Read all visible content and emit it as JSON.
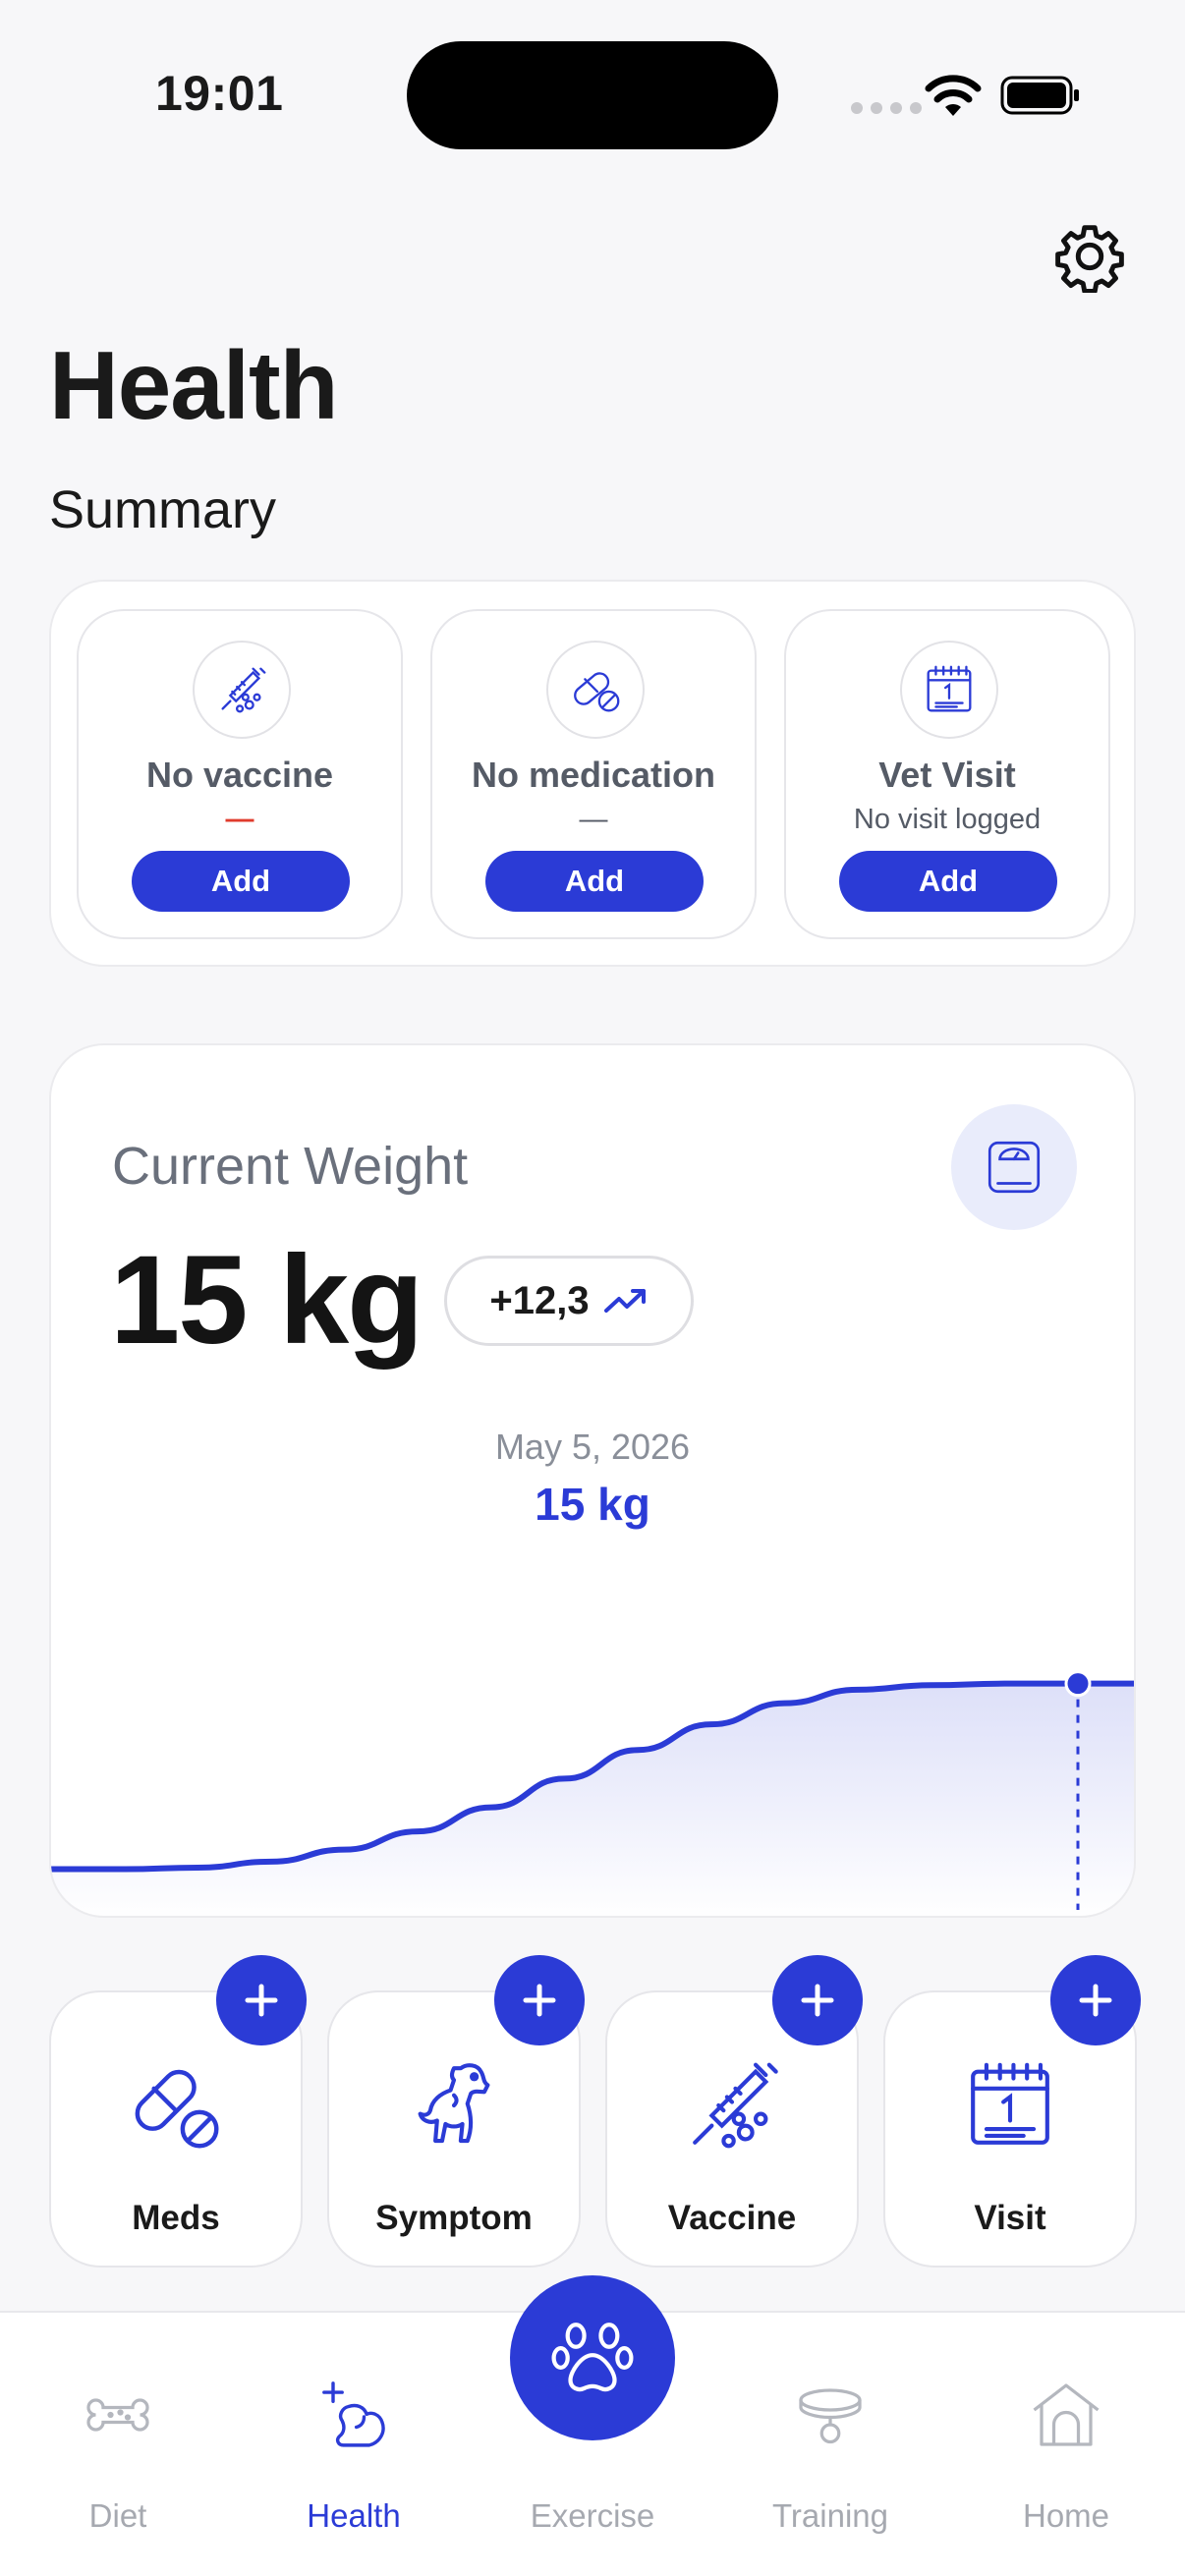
{
  "status_bar": {
    "time": "19:01"
  },
  "header": {
    "title": "Health",
    "summary_title": "Summary"
  },
  "summary": [
    {
      "title": "No vaccine",
      "subtitle": "—",
      "button": "Add",
      "icon": "vaccine-icon"
    },
    {
      "title": "No medication",
      "subtitle": "—",
      "button": "Add",
      "icon": "pill-icon"
    },
    {
      "title": "Vet Visit",
      "subtitle": "No visit logged",
      "button": "Add",
      "icon": "calendar-icon"
    }
  ],
  "weight": {
    "label": "Current Weight",
    "value": "15 kg",
    "change": "+12,3",
    "selected_date": "May 5, 2026",
    "selected_value": "15 kg"
  },
  "chart_data": {
    "type": "area",
    "values": [
      2.7,
      2.7,
      2.8,
      3.2,
      4.0,
      5.2,
      6.8,
      8.7,
      10.6,
      12.3,
      13.7,
      14.6,
      14.9,
      15.0,
      15.0
    ],
    "highlight": {
      "date": "May 5, 2026",
      "value": 15
    },
    "grid": false
  },
  "quick_actions": [
    {
      "label": "Meds",
      "icon": "pill-icon"
    },
    {
      "label": "Symptom",
      "icon": "dog-icon"
    },
    {
      "label": "Vaccine",
      "icon": "vaccine-icon"
    },
    {
      "label": "Visit",
      "icon": "calendar-icon"
    }
  ],
  "tabs": [
    {
      "label": "Diet",
      "icon": "bone-icon",
      "active": false
    },
    {
      "label": "Health",
      "icon": "health-dog-icon",
      "active": true
    },
    {
      "label": "Exercise",
      "icon": "paw-icon",
      "active": false
    },
    {
      "label": "Training",
      "icon": "collar-icon",
      "active": false
    },
    {
      "label": "Home",
      "icon": "house-icon",
      "active": false
    }
  ],
  "colors": {
    "accent": "#2b3bd6",
    "alert": "#e03b2c"
  }
}
